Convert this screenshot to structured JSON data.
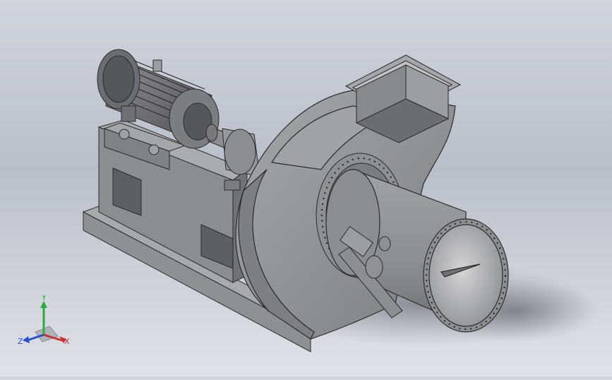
{
  "viewport": {
    "background_top": "#cfd4dd",
    "background_bottom": "#dfe2e8",
    "model_color": "#8f9296",
    "edge_color": "#2b2b2b"
  },
  "triad": {
    "x_label": "X",
    "y_label": "Y",
    "z_label": "Z",
    "x_color": "#c83232",
    "y_color": "#2eaa3c",
    "z_color": "#2a4fc8"
  }
}
